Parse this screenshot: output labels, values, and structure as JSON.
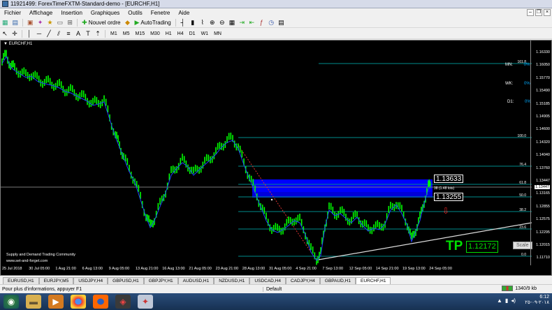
{
  "window": {
    "title": "11921499: ForexTimeFXTM-Standard-demo - [EURCHF,H1]"
  },
  "menu": [
    "Fichier",
    "Affichage",
    "Insertion",
    "Graphiques",
    "Outils",
    "Fenetre",
    "Aide"
  ],
  "toolbar": {
    "new_order": "Nouvel ordre",
    "autotrading": "AutoTrading"
  },
  "timeframes": [
    "M1",
    "M5",
    "M15",
    "M30",
    "H1",
    "H4",
    "D1",
    "W1",
    "MN"
  ],
  "chart": {
    "label": "EURCHF,H1",
    "footer1": "Supply and Demand Trading Community",
    "footer2": "www.set-and-forget.com",
    "price_box_upper": "1.13633",
    "price_box_lower": "1.13255",
    "zone_label": "38 (1.48 lots)",
    "tp_label": "TP",
    "tp_value": "1.12172",
    "scale_button": "Scale",
    "tf_labels": [
      {
        "name": "MN:",
        "value": "0%"
      },
      {
        "name": "WK:",
        "value": "0%"
      },
      {
        "name": "D1:",
        "value": "0%"
      }
    ],
    "fib_labels": [
      "161.8",
      "100.0",
      "76.4",
      "61.8",
      "50.0",
      "38.2",
      "23.6",
      "0.0"
    ],
    "y_ticks": [
      "1.16330",
      "1.16050",
      "1.15770",
      "1.15490",
      "1.15185",
      "1.14905",
      "1.14600",
      "1.14320",
      "1.14040",
      "1.13760",
      "1.13447",
      "1.13165",
      "1.12855",
      "1.12575",
      "1.12295",
      "1.12015",
      "1.11710"
    ],
    "x_ticks": [
      "25 Jul 2018",
      "30 Jul 05:00",
      "1 Aug 21:00",
      "6 Aug 13:00",
      "9 Aug 05:00",
      "13 Aug 21:00",
      "16 Aug 13:00",
      "21 Aug 05:00",
      "23 Aug 21:00",
      "28 Aug 13:00",
      "31 Aug 05:00",
      "4 Sep 21:00",
      "7 Sep 13:00",
      "12 Sep 05:00",
      "14 Sep 21:00",
      "19 Sep 13:00",
      "24 Sep 05:00"
    ],
    "colors": {
      "candles": "#00ff00",
      "zone": "#0000ff",
      "fib": "#008b8b",
      "text": "#ffffff",
      "tp": "#00e000"
    }
  },
  "tabs": [
    "EURUSD,H1",
    "EURJPY,M5",
    "USDJPY,H4",
    "GBPUSD,H1",
    "GBPJPY,H1",
    "AUDUSD,H1",
    "NZDUSD,H1",
    "USDCAD,H4",
    "CADJPY,H4",
    "GBPAUD,H1",
    "EURCHF,H1"
  ],
  "active_tab": "EURCHF,H1",
  "status": {
    "help": "Pour plus d'informations, appuyer F1",
    "profile": "Default",
    "traffic": "1340/9 kb"
  },
  "taskbar": {
    "time": "6:12",
    "date": "٢٠١٨-٠٩-٢٥"
  }
}
